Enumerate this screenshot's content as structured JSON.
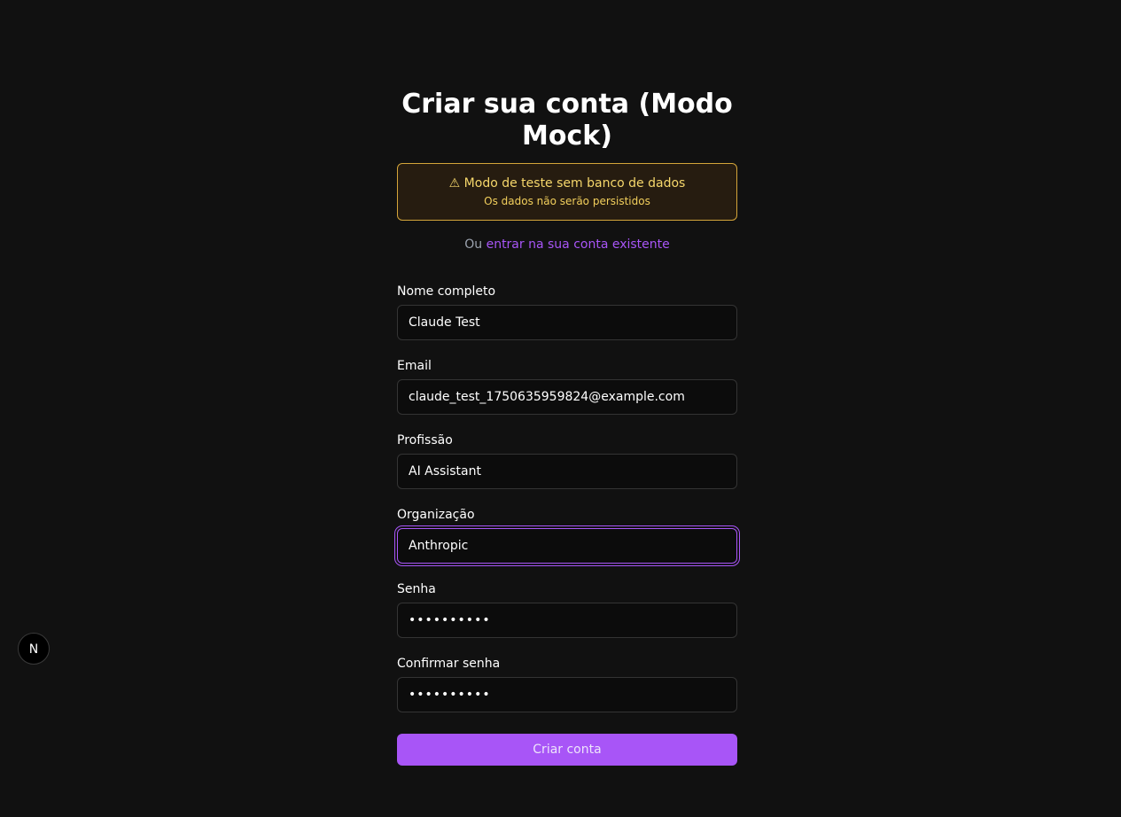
{
  "header": {
    "title": "Criar sua conta (Modo Mock)"
  },
  "notice": {
    "title": "⚠ Modo de teste sem banco de dados",
    "subtitle": "Os dados não serão persistidos"
  },
  "login_prompt": {
    "prefix": "Ou ",
    "link_label": "entrar na sua conta existente"
  },
  "form": {
    "fields": [
      {
        "label": "Nome completo",
        "value": "Claude Test",
        "type": "text"
      },
      {
        "label": "Email",
        "value": "claude_test_1750635959824@example.com",
        "type": "email"
      },
      {
        "label": "Profissão",
        "value": "AI Assistant",
        "type": "text"
      },
      {
        "label": "Organização",
        "value": "Anthropic",
        "type": "text",
        "focused": true
      },
      {
        "label": "Senha",
        "value": "1234567890",
        "type": "password"
      },
      {
        "label": "Confirmar senha",
        "value": "1234567890",
        "type": "password"
      }
    ],
    "submit_label": "Criar conta"
  },
  "dev_badge": {
    "icon": "nextjs-logo-icon",
    "letter": "N"
  },
  "colors": {
    "background": "#111111",
    "accent": "#a855f7",
    "notice_border": "#d4a53a",
    "notice_text": "#f6d76b"
  }
}
